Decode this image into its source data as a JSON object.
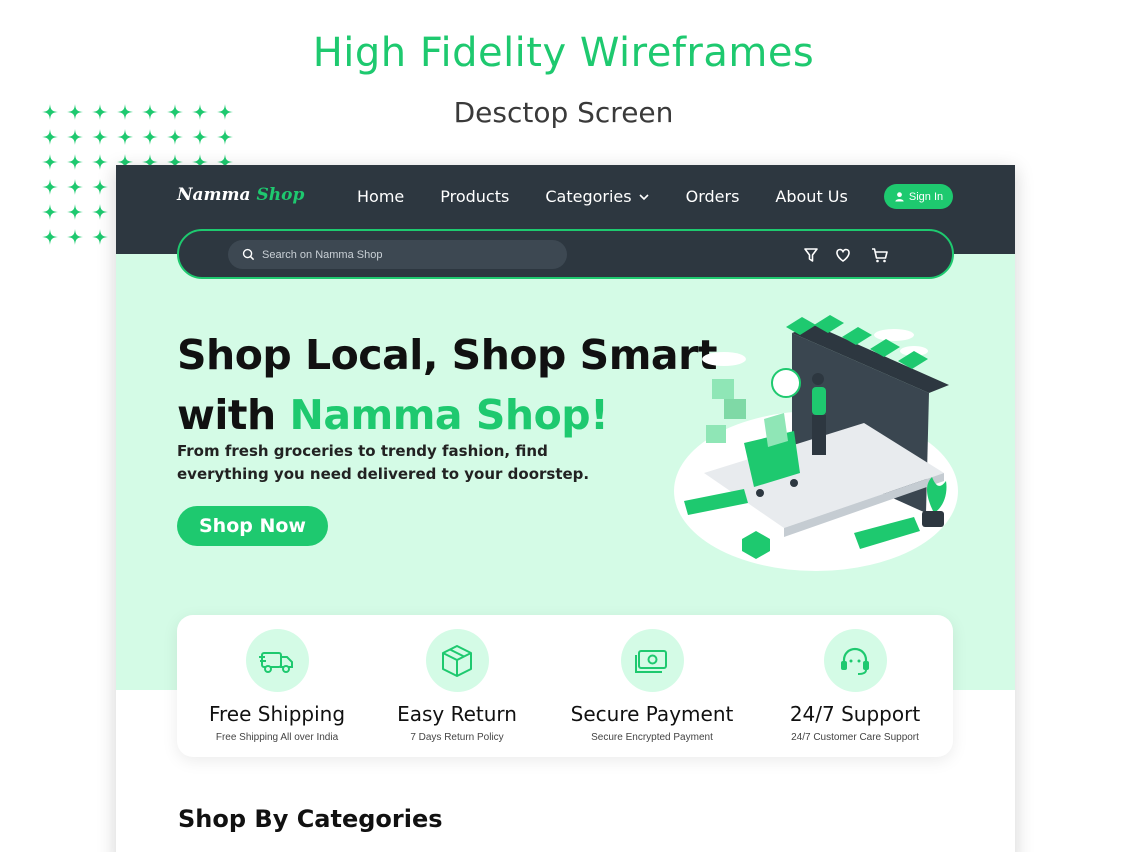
{
  "header": {
    "title": "High  Fidelity Wireframes",
    "subtitle": "Desctop Screen"
  },
  "colors": {
    "accent": "#1ec96f",
    "navbar": "#2d3740",
    "hero_bg": "#d4fbe6"
  },
  "navbar": {
    "logo_part1": "Namma",
    "logo_part2": "Shop",
    "links": [
      "Home",
      "Products",
      "Categories",
      "Orders",
      "About Us"
    ],
    "signin_label": "Sign In",
    "search_placeholder": "Search on Namma Shop",
    "icons": [
      "filter-icon",
      "heart-icon",
      "cart-icon"
    ]
  },
  "hero": {
    "heading_line1": "Shop Local, Shop Smart",
    "heading_line2_prefix": "with ",
    "heading_line2_accent": "Namma Shop!",
    "description": "From fresh groceries to trendy fashion, find everything you need  delivered to your doorstep.",
    "cta_label": "Shop Now"
  },
  "features": [
    {
      "icon": "truck-icon",
      "title": "Free Shipping",
      "subtitle": "Free Shipping All over India"
    },
    {
      "icon": "box-icon",
      "title": "Easy Return",
      "subtitle": "7 Days Return Policy"
    },
    {
      "icon": "cash-icon",
      "title": "Secure Payment",
      "subtitle": "Secure Encrypted Payment"
    },
    {
      "icon": "headset-icon",
      "title": "24/7 Support",
      "subtitle": "24/7 Customer Care Support"
    }
  ],
  "categories": {
    "title": "Shop By Categories"
  }
}
